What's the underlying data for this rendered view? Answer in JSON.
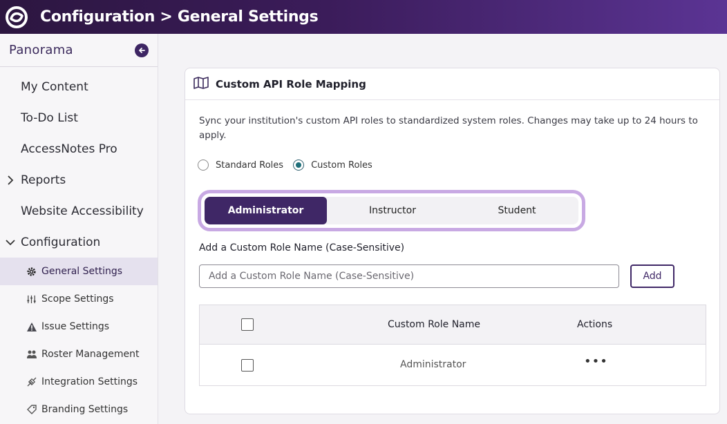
{
  "header": {
    "title": "Configuration > General Settings",
    "logo_icon": "panorama-logo",
    "bg_color": "#3b1c5a"
  },
  "sidebar": {
    "brand": "Panorama",
    "collapse_icon": "arrow-left-circle-icon",
    "items": [
      {
        "label": "My Content"
      },
      {
        "label": "To-Do List"
      },
      {
        "label": "AccessNotes Pro"
      },
      {
        "label": "Reports",
        "caret": "chevron-right"
      },
      {
        "label": "Website Accessibility"
      },
      {
        "label": "Configuration",
        "caret": "chevron-down"
      }
    ],
    "sub_items": [
      {
        "label": "General Settings",
        "icon": "gear-icon",
        "active": true
      },
      {
        "label": "Scope Settings",
        "icon": "sliders-icon"
      },
      {
        "label": "Issue Settings",
        "icon": "warning-icon"
      },
      {
        "label": "Roster Management",
        "icon": "users-icon"
      },
      {
        "label": "Integration Settings",
        "icon": "plug-icon"
      },
      {
        "label": "Branding Settings",
        "icon": "tag-icon"
      }
    ]
  },
  "card": {
    "title": "Custom API Role Mapping",
    "title_icon": "map-icon",
    "description": "Sync your institution's custom API roles to standardized system roles. Changes may take up to 24 hours to apply.",
    "radios": [
      {
        "label": "Standard Roles",
        "checked": false
      },
      {
        "label": "Custom Roles",
        "checked": true
      }
    ],
    "segments": [
      {
        "label": "Administrator",
        "active": true
      },
      {
        "label": "Instructor",
        "active": false
      },
      {
        "label": "Student",
        "active": false
      }
    ],
    "field_label": "Add a Custom Role Name (Case-Sensitive)",
    "input_placeholder": "Add a Custom Role Name (Case-Sensitive)",
    "add_label": "Add",
    "table": {
      "headers": [
        "Custom Role Name",
        "Actions"
      ],
      "rows": [
        {
          "name": "Administrator",
          "actions": "•••"
        }
      ]
    }
  },
  "colors": {
    "accent": "#3f2766",
    "segment_border": "#c8a9e3",
    "radio_checked": "#1f6f7a"
  }
}
